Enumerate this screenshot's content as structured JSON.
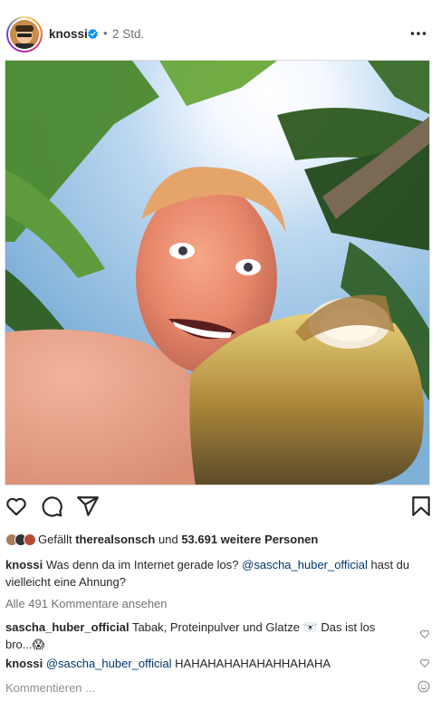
{
  "post": {
    "username": "knossi",
    "dot": "•",
    "time": "2 Std."
  },
  "likes": {
    "prefix": "Gefällt",
    "user": "therealsonsch",
    "middle": "und",
    "count": "53.691 weitere Personen"
  },
  "caption": {
    "username": "knossi",
    "text_before": "Was denn da im Internet gerade los?",
    "mention": "@sascha_huber_official",
    "text_after": "hast du vielleicht eine Ahnung?"
  },
  "view_comments": "Alle 491 Kommentare ansehen",
  "comments": [
    {
      "username": "sascha_huber_official",
      "text": "Tabak, Proteinpulver und Glatze 🐻‍❄️ Das ist los bro...😱"
    },
    {
      "username": "knossi",
      "mention": "@sascha_huber_official",
      "text": "HAHAHAHAHAHAHHAHAHA"
    }
  ],
  "add_comment_placeholder": "Kommentieren ...",
  "icons": [
    "verified-badge-icon",
    "more-options-icon",
    "heart-icon",
    "comment-icon",
    "share-icon",
    "bookmark-icon",
    "emoji-icon"
  ],
  "colors": {
    "verified": "#0095f6",
    "mention": "#00376b",
    "muted": "#737373"
  }
}
